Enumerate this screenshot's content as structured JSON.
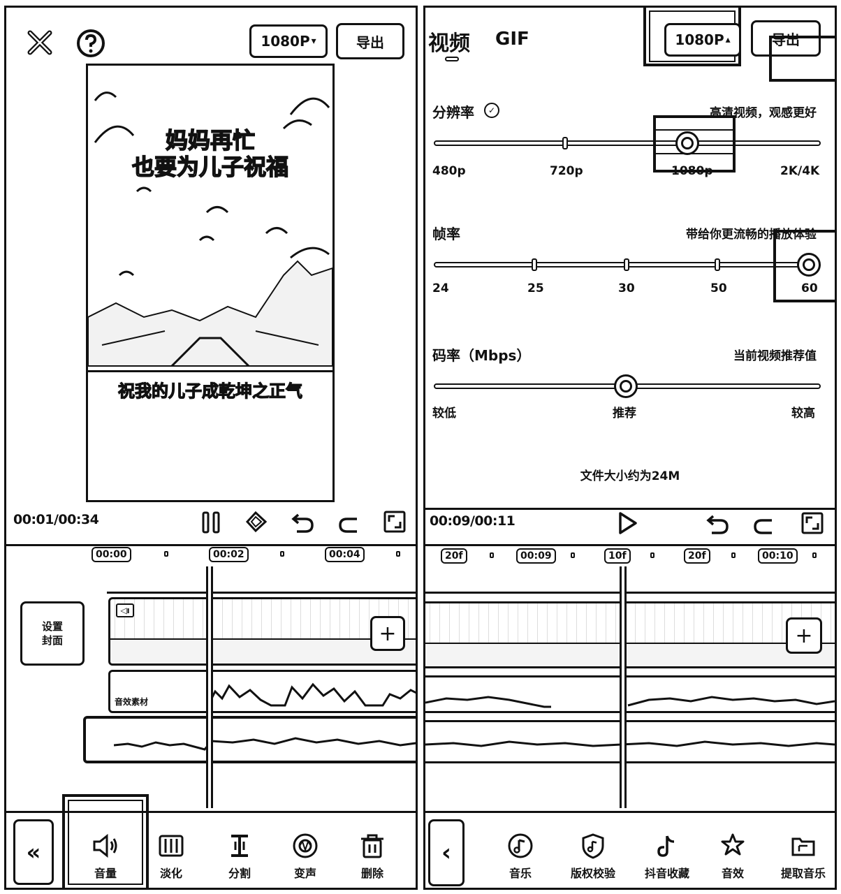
{
  "left": {
    "top_bar": {
      "resolution_label": "1080P",
      "export_label": "导出"
    },
    "preview": {
      "headline_line1": "妈妈再忙",
      "headline_line2": "也要为儿子祝福",
      "subtitle": "祝我的儿子成乾坤之正气"
    },
    "playback": {
      "time": "00:01/00:34"
    },
    "ruler": [
      "00:00",
      "00:02",
      "00:04"
    ],
    "cover_button_line1": "设置",
    "cover_button_line2": "封面",
    "audio_track_label": "音效素材",
    "toolbar": [
      {
        "label": "音量",
        "icon": "volume-icon"
      },
      {
        "label": "淡化",
        "icon": "fade-icon"
      },
      {
        "label": "分割",
        "icon": "split-icon"
      },
      {
        "label": "变声",
        "icon": "voice-change-icon"
      },
      {
        "label": "删除",
        "icon": "delete-icon"
      }
    ]
  },
  "right": {
    "tabs": {
      "video": "视频",
      "gif": "GIF"
    },
    "top_bar": {
      "resolution_label": "1080P",
      "export_label": "导出"
    },
    "resolution": {
      "title": "分辨率",
      "hint": "高清视频，观感更好",
      "ticks": [
        "480p",
        "720p",
        "1080p",
        "2K/4K"
      ],
      "selected_index": 2
    },
    "frame_rate": {
      "title": "帧率",
      "hint": "带给你更流畅的播放体验",
      "ticks": [
        "24",
        "25",
        "30",
        "50",
        "60"
      ],
      "selected_index": 4
    },
    "bitrate": {
      "title": "码率（Mbps）",
      "hint": "当前视频推荐值",
      "ticks": [
        "较低",
        "推荐",
        "较高"
      ],
      "selected_index": 1
    },
    "file_size": "文件大小约为24M",
    "playback": {
      "time": "00:09/00:11"
    },
    "ruler": [
      "20f",
      "00:09",
      "10f",
      "20f",
      "00:10"
    ],
    "toolbar": [
      {
        "label": "音乐",
        "icon": "music-icon"
      },
      {
        "label": "版权校验",
        "icon": "copyright-check-icon"
      },
      {
        "label": "抖音收藏",
        "icon": "douyin-favorites-icon"
      },
      {
        "label": "音效",
        "icon": "sound-effect-icon"
      },
      {
        "label": "提取音乐",
        "icon": "extract-music-icon"
      }
    ]
  }
}
